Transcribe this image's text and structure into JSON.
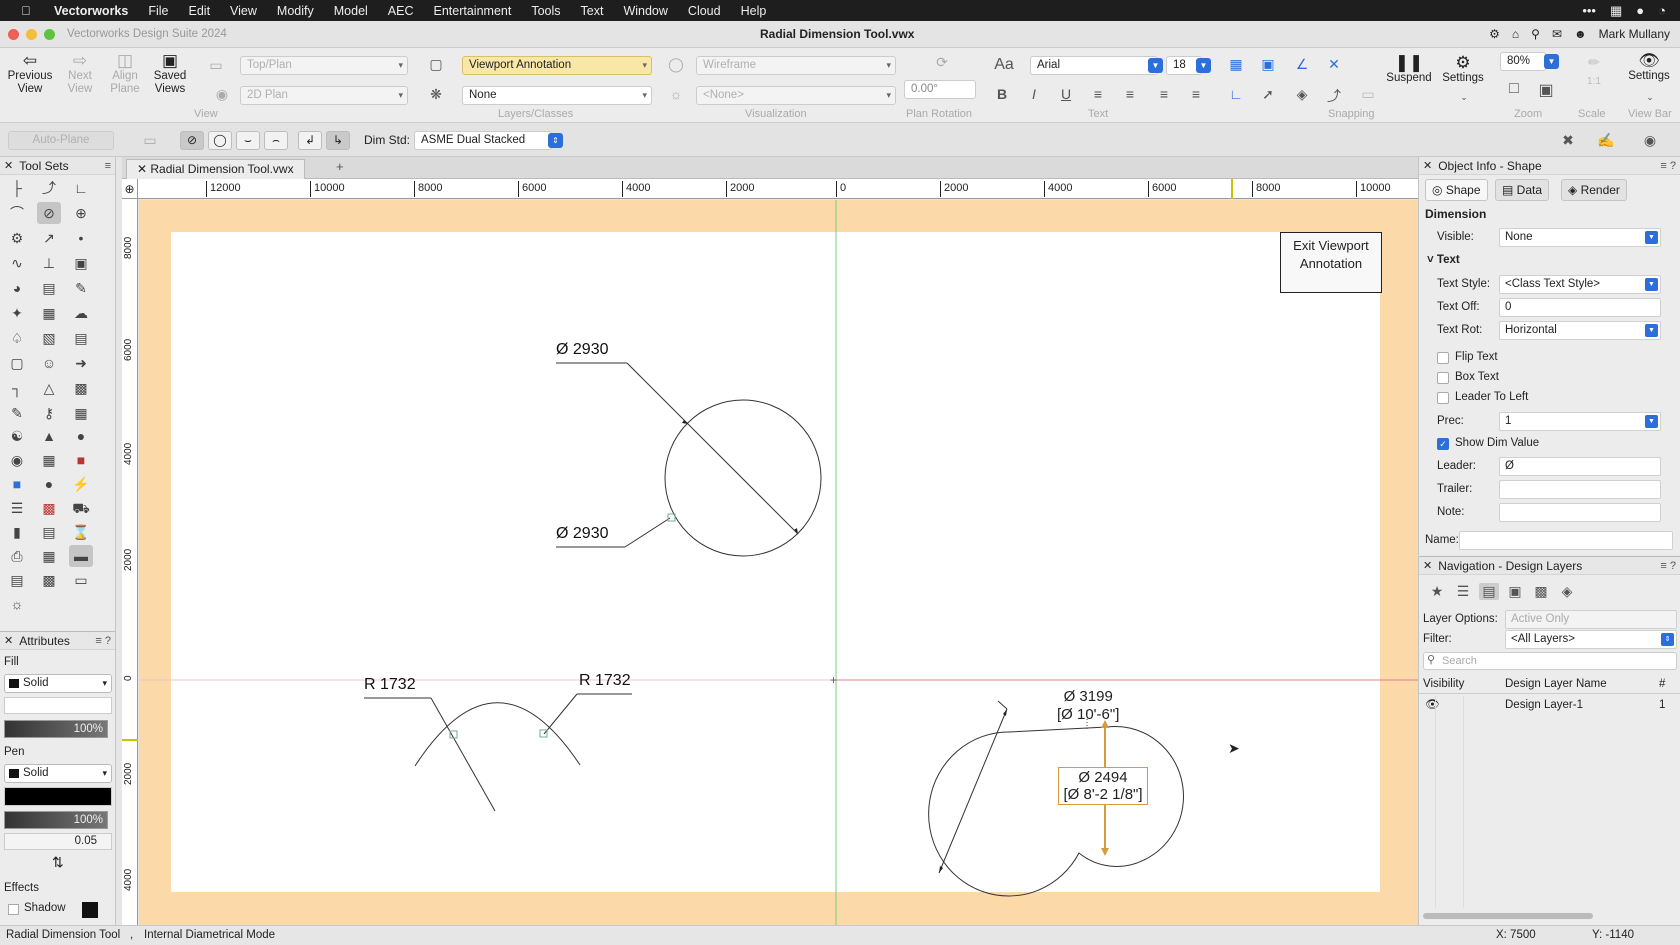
{
  "menubar": {
    "app": "Vectorworks",
    "items": [
      "File",
      "Edit",
      "View",
      "Modify",
      "Model",
      "AEC",
      "Entertainment",
      "Tools",
      "Text",
      "Window",
      "Cloud",
      "Help"
    ]
  },
  "titlebar": {
    "app_title": "Vectorworks Design Suite 2024",
    "doc_title": "Radial Dimension Tool.vwx",
    "user": "Mark Mullany"
  },
  "toolbar": {
    "previous_view": "Previous View",
    "next_view": "Next View",
    "align_plane": "Align Plane",
    "saved_views": "Saved Views",
    "view_dropdown": "Top/Plan",
    "projection_dropdown": "2D Plan",
    "view_group": "View",
    "layer_dropdown": "Viewport Annotation",
    "class_dropdown": "None",
    "layers_group": "Layers/Classes",
    "render_dropdown": "Wireframe",
    "vis_dropdown": "<None>",
    "vis_group": "Visualization",
    "rotation_value": "0.00°",
    "rotation_group": "Plan Rotation",
    "font": "Arial",
    "font_size": "18",
    "text_group": "Text",
    "snapping_group": "Snapping",
    "suspend": "Suspend",
    "settings": "Settings",
    "zoom_value": "80%",
    "zoom_group": "Zoom",
    "scale_group": "Scale",
    "scale_value": "1:1",
    "settings2": "Settings",
    "viewbar_group": "View Bar"
  },
  "modebar": {
    "auto_plane": "Auto-Plane",
    "dim_std_label": "Dim Std:",
    "dim_std_value": "ASME Dual Stacked"
  },
  "tab": {
    "label": "Radial Dimension Tool.vwx"
  },
  "toolsets": {
    "title": "Tool Sets"
  },
  "attributes": {
    "title": "Attributes",
    "fill_label": "Fill",
    "fill_style": "Solid",
    "fill_opacity": "100%",
    "pen_label": "Pen",
    "pen_style": "Solid",
    "pen_opacity": "100%",
    "line_weight": "0.05",
    "effects_label": "Effects",
    "shadow_label": "Shadow"
  },
  "rulers": {
    "top": [
      "12000",
      "10000",
      "8000",
      "6000",
      "4000",
      "2000",
      "0",
      "2000",
      "4000",
      "6000",
      "8000",
      "10000"
    ],
    "left": [
      "8000",
      "6000",
      "4000",
      "2000",
      "0",
      "2000",
      "4000"
    ]
  },
  "canvas": {
    "dims": {
      "d1": "Ø 2930",
      "d2": "Ø 2930",
      "r1": "R 1732",
      "r2": "R 1732",
      "d3a": "Ø 3199",
      "d3b": "[Ø 10'-6\"]",
      "d4a": "Ø 2494",
      "d4b": "[Ø 8'-2 1/8\"]"
    },
    "exit_button": "Exit Viewport Annotation"
  },
  "object_info": {
    "title": "Object Info - Shape",
    "tabs": [
      "Shape",
      "Data",
      "Render"
    ],
    "section": "Dimension",
    "visible_label": "Visible:",
    "visible_value": "None",
    "text_label": "Text",
    "text_style_label": "Text Style:",
    "text_style_value": "<Class Text Style>",
    "text_off_label": "Text Off:",
    "text_off_value": "0",
    "text_rot_label": "Text Rot:",
    "text_rot_value": "Horizontal",
    "flip_text": "Flip Text",
    "box_text": "Box Text",
    "leader_to_left": "Leader To Left",
    "prec_label": "Prec:",
    "prec_value": "1",
    "show_dim_value": "Show Dim Value",
    "leader_label": "Leader:",
    "leader_value": "Ø",
    "trailer_label": "Trailer:",
    "note_label": "Note:",
    "name_label": "Name:"
  },
  "navigation": {
    "title": "Navigation - Design Layers",
    "layer_options_label": "Layer Options:",
    "layer_options_value": "Active Only",
    "filter_label": "Filter:",
    "filter_value": "<All Layers>",
    "search_placeholder": "Search",
    "col_visibility": "Visibility",
    "col_name": "Design Layer Name",
    "col_num": "#",
    "rows": [
      {
        "name": "Design Layer-1",
        "num": "1"
      }
    ]
  },
  "status": {
    "tool": "Radial Dimension Tool",
    "separator": ",",
    "mode": "Internal Diametrical Mode",
    "x": "X: 7500",
    "y": "Y: -1140"
  },
  "colors": {
    "canvas_bg": "#fbd9a8",
    "accent": "#2c6fd8",
    "dim_highlight": "#d79a39",
    "axis_green": "#4caf50",
    "axis_red": "#e05a6a"
  }
}
